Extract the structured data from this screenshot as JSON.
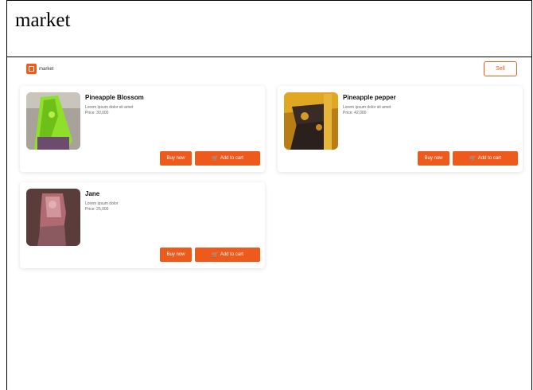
{
  "page": {
    "header": "market"
  },
  "app": {
    "logo_text": "market",
    "sell_label": "Sell"
  },
  "products": [
    {
      "name": "Pineapple Blossom",
      "description": "Lorem ipsum dolor sit amet",
      "price": "Price: 30,000"
    },
    {
      "name": "Pineapple pepper",
      "description": "Lorem ipsum dolor sit amet",
      "price": "Price: 42,000"
    },
    {
      "name": "Jane",
      "description": "Lorem ipsum dolor",
      "price": "Price: 25,000"
    }
  ],
  "buttons": {
    "buy_label": "Buy now",
    "cart_label": "Add to cart"
  },
  "icons": {
    "logo": "market-logo-icon",
    "cart": "cart-icon"
  },
  "colors": {
    "accent": "#ee5a1c"
  }
}
